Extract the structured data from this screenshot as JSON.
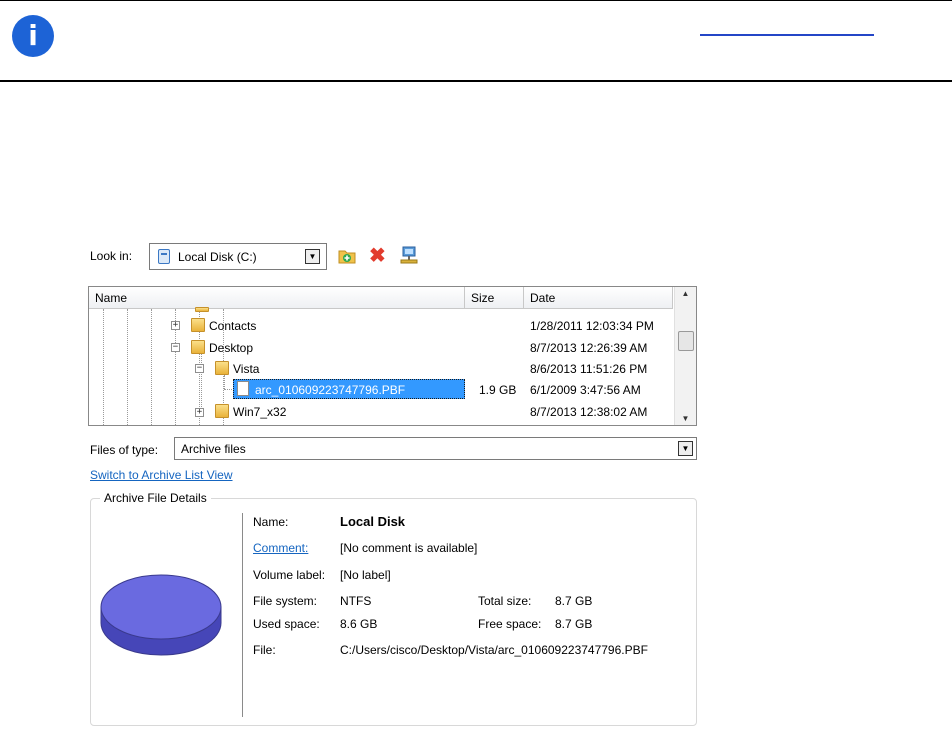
{
  "look_in": {
    "label": "Look in:",
    "value": "Local Disk (C:)"
  },
  "toolbar": {
    "new_folder_icon": "folder-add-icon",
    "delete_icon": "delete-icon",
    "network_icon": "network-icon"
  },
  "file_list": {
    "columns": {
      "name": "Name",
      "size": "Size",
      "date": "Date"
    },
    "rows": [
      {
        "name": "Contacts",
        "size": "",
        "date": "1/28/2011 12:03:34 PM"
      },
      {
        "name": "Desktop",
        "size": "",
        "date": "8/7/2013 12:26:39 AM"
      },
      {
        "name": "Vista",
        "size": "",
        "date": "8/6/2013 11:51:26 PM"
      },
      {
        "name": "arc_010609223747796.PBF",
        "size": "1.9 GB",
        "date": "6/1/2009 3:47:56 AM"
      },
      {
        "name": "Win7_x32",
        "size": "",
        "date": "8/7/2013 12:38:02 AM"
      }
    ]
  },
  "files_of_type": {
    "label": "Files of type:",
    "value": "Archive files"
  },
  "switch_link": "Switch to Archive List View",
  "details": {
    "legend": "Archive File Details",
    "name_label": "Name:",
    "name_value": "Local Disk",
    "comment_label": "Comment:",
    "comment_value": "[No comment is available]",
    "volume_label": "Volume label:",
    "volume_value": "[No label]",
    "fs_label": "File system:",
    "fs_value": "NTFS",
    "total_label": "Total size:",
    "total_value": "8.7 GB",
    "used_label": "Used space:",
    "used_value": "8.6 GB",
    "free_label": "Free space:",
    "free_value": "8.7 GB",
    "file_label": "File:",
    "file_value": "C:/Users/cisco/Desktop/Vista/arc_010609223747796.PBF"
  },
  "colors": {
    "info_blue": "#1d63d6",
    "selection": "#3399ff",
    "link": "#1565c0",
    "disk": "#6a6ae0"
  }
}
